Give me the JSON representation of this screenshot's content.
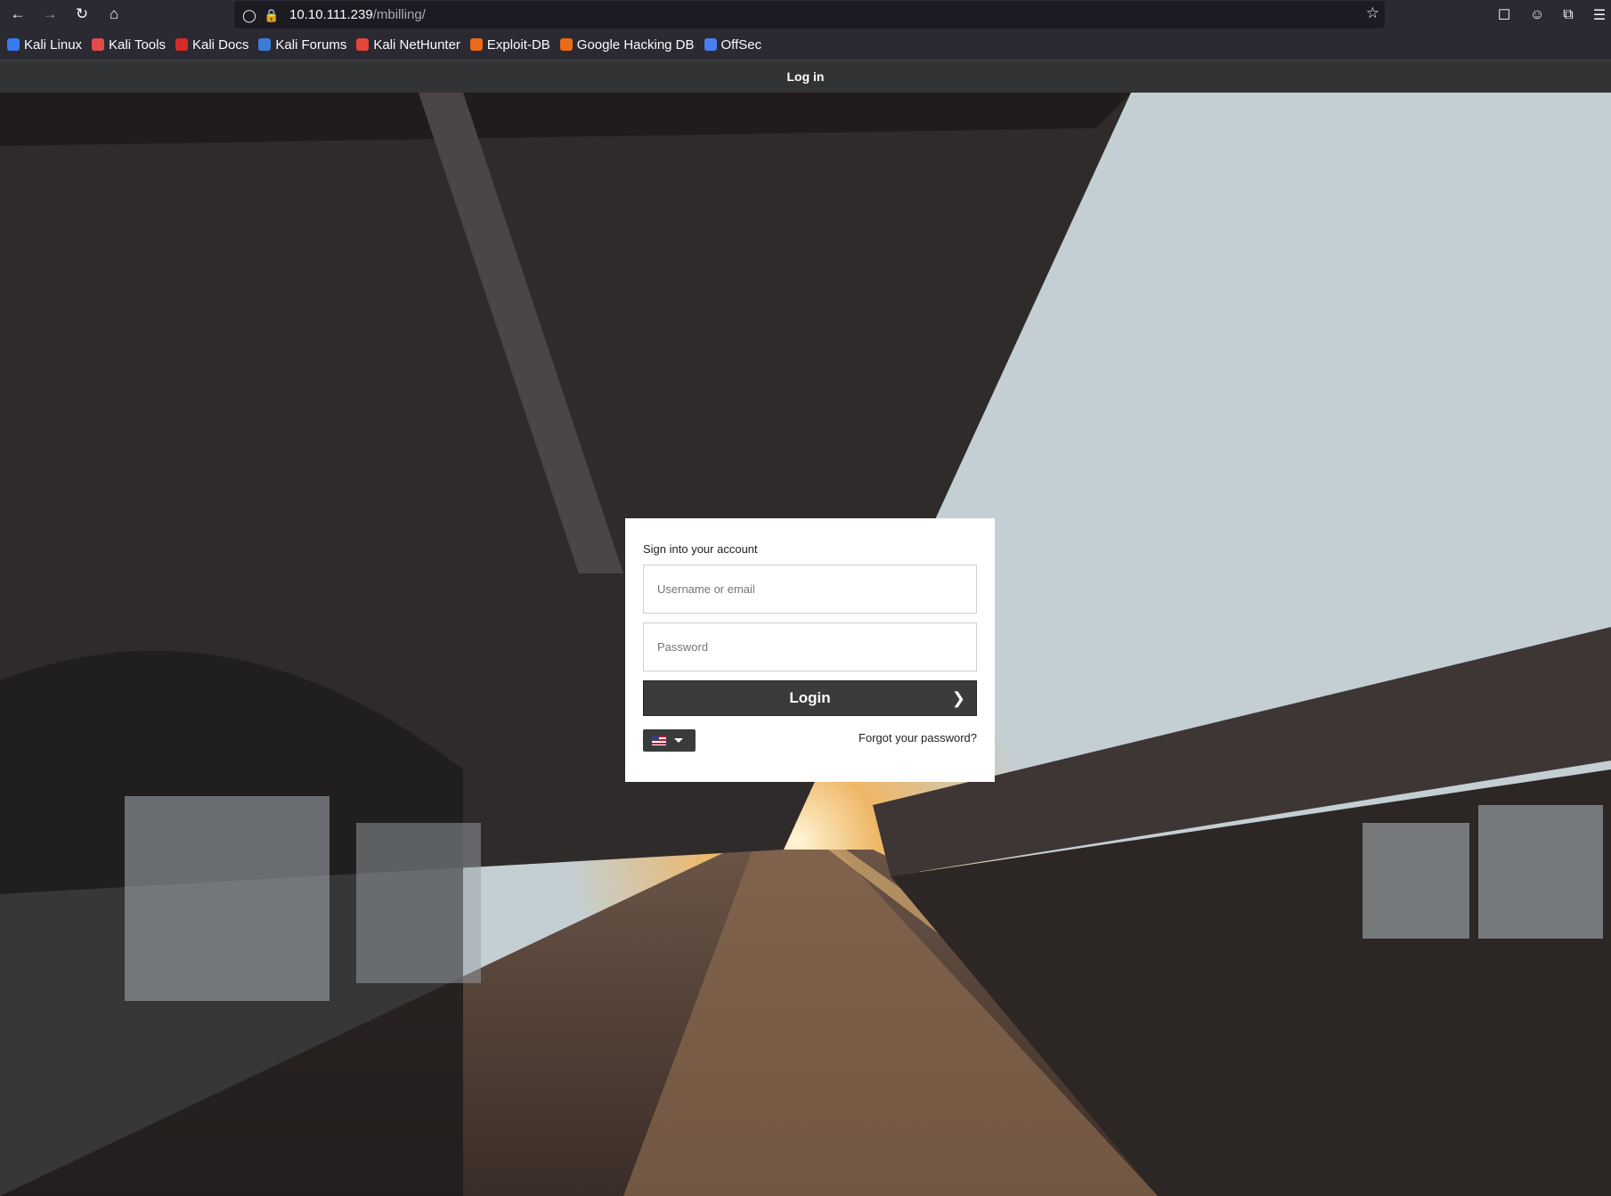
{
  "browser": {
    "url_host": "10.10.111.239",
    "url_path": "/mbilling/",
    "bookmarks": [
      {
        "label": "Kali Linux",
        "color": "#367bf0"
      },
      {
        "label": "Kali Tools",
        "color": "#e34b4b"
      },
      {
        "label": "Kali Docs",
        "color": "#d42a2a"
      },
      {
        "label": "Kali Forums",
        "color": "#3b7dd8"
      },
      {
        "label": "Kali NetHunter",
        "color": "#e2463b"
      },
      {
        "label": "Exploit-DB",
        "color": "#ea6a1a"
      },
      {
        "label": "Google Hacking DB",
        "color": "#ea6a1a"
      },
      {
        "label": "OffSec",
        "color": "#4a7ff0"
      }
    ]
  },
  "app": {
    "header_title": "Log in"
  },
  "login": {
    "heading": "Sign into your account",
    "username_placeholder": "Username or email",
    "password_placeholder": "Password",
    "button_label": "Login",
    "forgot_link": "Forgot your password?",
    "language_icon": "us-flag-icon"
  }
}
